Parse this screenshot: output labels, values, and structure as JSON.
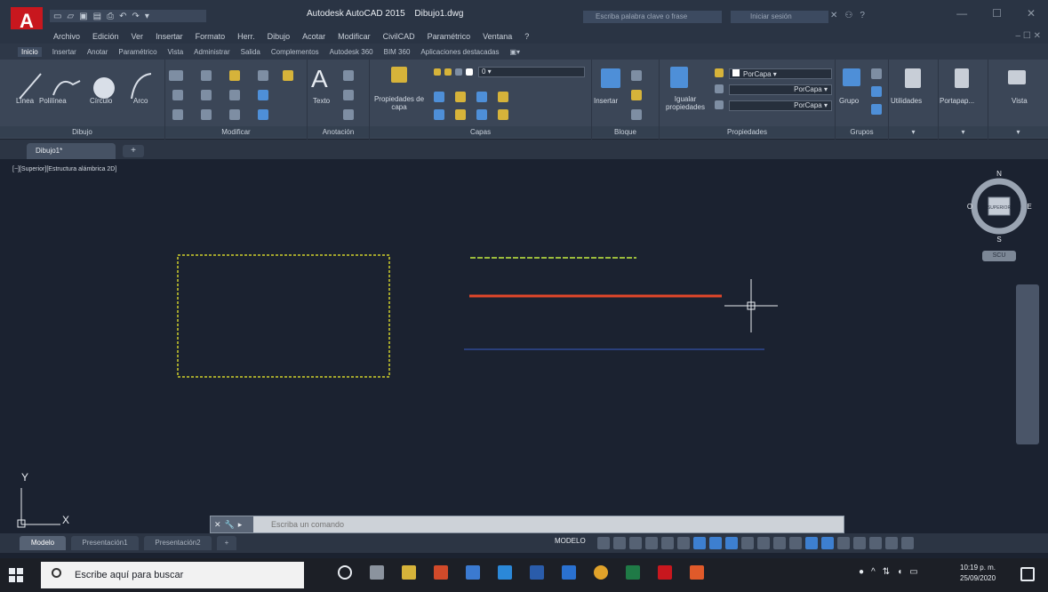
{
  "app": {
    "title": "Autodesk AutoCAD 2015",
    "file": "Dibujo1.dwg",
    "search_placeholder": "Escriba palabra clave o frase",
    "signin": "Iniciar sesión"
  },
  "menu": [
    "Archivo",
    "Edición",
    "Ver",
    "Insertar",
    "Formato",
    "Herr.",
    "Dibujo",
    "Acotar",
    "Modificar",
    "CivilCAD",
    "Paramétrico",
    "Ventana",
    "?"
  ],
  "ribbon_tabs": [
    "Inicio",
    "Insertar",
    "Anotar",
    "Paramétrico",
    "Vista",
    "Administrar",
    "Salida",
    "Complementos",
    "Autodesk 360",
    "BIM 360",
    "Aplicaciones destacadas"
  ],
  "ribbon": {
    "draw_tools": [
      "Línea",
      "Polilínea",
      "Círculo",
      "Arco"
    ],
    "text_tool": "Texto",
    "layer_props": "Propiedades de capa",
    "insert_tool": "Insertar",
    "match_props": "Igualar propiedades",
    "bycolor": "PorCapa",
    "byline1": "PorCapa",
    "byline2": "PorCapa",
    "groups": "Grupo",
    "utilities": "Utilidades",
    "clipboard": "Portapap...",
    "view": "Vista",
    "panels": {
      "draw": "Dibujo",
      "modify": "Modificar",
      "annotate": "Anotación",
      "layers": "Capas",
      "block": "Bloque",
      "props": "Propiedades",
      "groups": "Grupos"
    }
  },
  "doc_tab": "Dibujo1*",
  "view_label": "[−][Superior][Estructura alámbrica 2D]",
  "viewcube": {
    "n": "N",
    "s": "S",
    "e": "E",
    "o": "O",
    "face": "SUPERIOR",
    "wcs": "SCU"
  },
  "cmd": {
    "placeholder": "Escriba un comando"
  },
  "layout_tabs": [
    "Modelo",
    "Presentación1",
    "Presentación2"
  ],
  "status": {
    "model": "MODELO"
  },
  "taskbar": {
    "search": "Escribe aquí para buscar",
    "time": "10:19 p. m.",
    "date": "25/09/2020"
  },
  "colors": {
    "rect": "#cfd02a",
    "line_green": "#9cbc3c",
    "line_red": "#e2472a",
    "line_blue": "#2a3f7a",
    "accent": "#c8171e"
  }
}
